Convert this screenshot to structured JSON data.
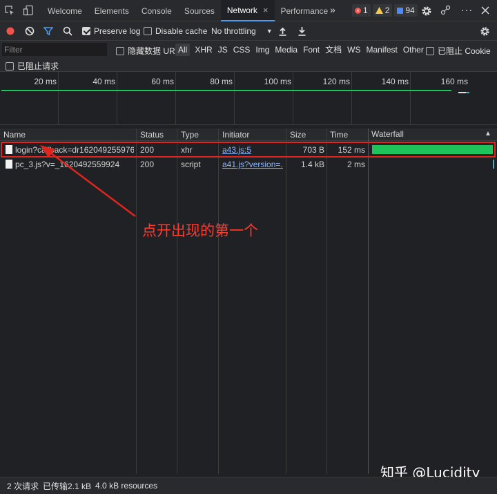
{
  "tabs": [
    {
      "label": "Welcome",
      "active": false
    },
    {
      "label": "Elements",
      "active": false
    },
    {
      "label": "Console",
      "active": false
    },
    {
      "label": "Sources",
      "active": false
    },
    {
      "label": "Network",
      "active": true
    },
    {
      "label": "Performance",
      "active": false
    }
  ],
  "tab_close": "×",
  "more_tabs": "»",
  "counts": {
    "errors": "1",
    "warnings": "2",
    "messages": "94"
  },
  "toolbar": {
    "preserve_log": "Preserve log",
    "preserve_log_checked": true,
    "disable_cache": "Disable cache",
    "disable_cache_checked": false,
    "throttling": "No throttling"
  },
  "filter": {
    "placeholder": "Filter",
    "hide_data_url": "隐藏数据 URL",
    "types": [
      "All",
      "XHR",
      "JS",
      "CSS",
      "Img",
      "Media",
      "Font",
      "文档",
      "WS",
      "Manifest",
      "Other"
    ],
    "selected_type": "All",
    "blocked_cookies": "已阻止 Cookie",
    "blocked_requests": "已阻止请求"
  },
  "overview": {
    "ticks": [
      "20 ms",
      "40 ms",
      "60 ms",
      "80 ms",
      "100 ms",
      "120 ms",
      "140 ms",
      "160 ms"
    ]
  },
  "table": {
    "columns": {
      "name": "Name",
      "status": "Status",
      "type": "Type",
      "initiator": "Initiator",
      "size": "Size",
      "time": "Time",
      "waterfall": "Waterfall"
    },
    "sort_indicator": "▲",
    "rows": [
      {
        "name": "login?callback=dr162049255976...",
        "status": "200",
        "type": "xhr",
        "initiator": "a43.js:5",
        "size": "703 B",
        "time": "152 ms",
        "waterfall_start": 0.01,
        "waterfall_end": 0.99
      },
      {
        "name": "pc_3.js?v=_1620492559924",
        "status": "200",
        "type": "script",
        "initiator": "a41.js?version=...",
        "size": "1.4 kB",
        "time": "2 ms",
        "waterfall_start": 0.99,
        "waterfall_end": 1.0
      }
    ]
  },
  "annotation": {
    "text": "点开出现的第一个"
  },
  "watermark": "知乎 @Lucidity",
  "status_bar": {
    "requests": "2 次请求",
    "transferred": "已传输2.1 kB",
    "resources": "4.0 kB resources"
  },
  "colors": {
    "accent": "#4c9df3",
    "annotation": "#e0251e",
    "waterfall_bar": "#1fc35b",
    "record": "#f0534b"
  }
}
